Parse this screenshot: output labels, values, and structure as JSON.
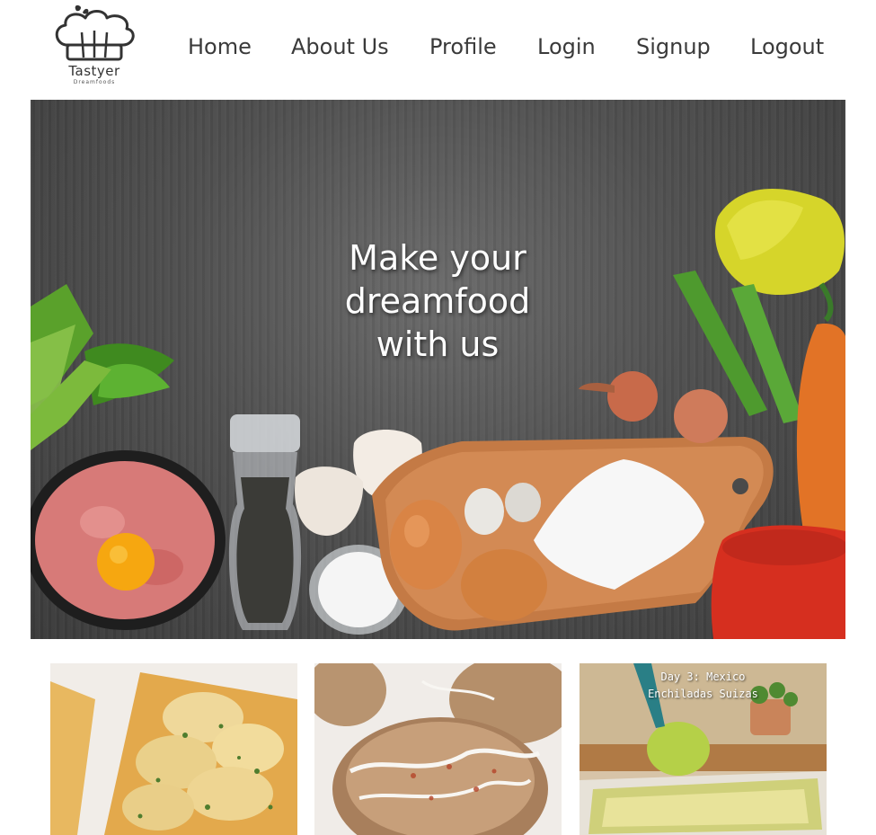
{
  "header": {
    "logo": {
      "name": "Tastyer",
      "sub": "Dreamfoods"
    },
    "nav": [
      {
        "label": "Home"
      },
      {
        "label": "About Us"
      },
      {
        "label": "Profile"
      },
      {
        "label": "Login"
      },
      {
        "label": "Signup"
      },
      {
        "label": "Logout"
      }
    ]
  },
  "hero": {
    "title_line1": "Make your",
    "title_line2": "dreamfood",
    "title_line3": "with us"
  },
  "cards": [
    {
      "image": "potato-herb-tart"
    },
    {
      "image": "crumb-muffin"
    },
    {
      "image": "enchiladas-suizas",
      "caption_line1": "Day 3: Mexico",
      "caption_line2": "Enchiladas Suizas"
    }
  ]
}
